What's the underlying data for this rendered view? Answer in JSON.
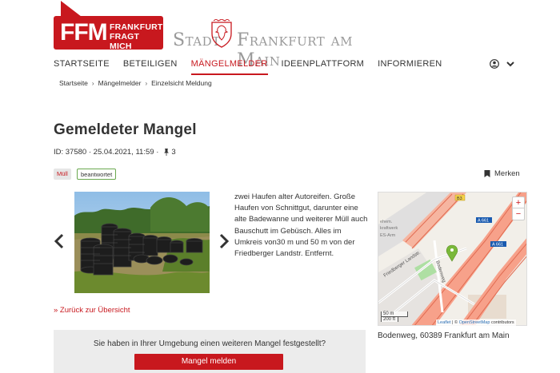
{
  "logo": {
    "abbr": "FFM",
    "line1": "FRANKFURT",
    "line2": "FRAGT MICH"
  },
  "city_logo": {
    "word1": "Stadt",
    "word2": "Frankfurt am Main"
  },
  "nav": {
    "items": [
      "STARTSEITE",
      "BETEILIGEN",
      "MÄNGELMELDER",
      "IDEENPLATTFORM",
      "INFORMIEREN"
    ],
    "active": "MÄNGELMELDER"
  },
  "breadcrumb": [
    "Startseite",
    "Mängelmelder",
    "Einzelsicht Meldung"
  ],
  "page_title": "Gemeldeter Mangel",
  "meta": {
    "id": "ID: 37580",
    "datetime": "25.04.2021, 11:59",
    "pins": "3"
  },
  "tags": {
    "category": "Müll",
    "status": "beantwortet"
  },
  "bookmark_label": "Merken",
  "description": "zwei Haufen alter Autoreifen. Große Haufen von Schnittgut, darunter eine alte Badewanne und weiterer Müll auch Bauschutt im Gebüsch. Alles im Umkreis von30 m und 50 m von der Friedberger Landstr. Entfernt.",
  "map": {
    "zoom_in": "+",
    "zoom_out": "−",
    "scale_m": "50 m",
    "scale_ft": "200 ft",
    "attribution_leaflet": "Leaflet",
    "attribution_sep": " | © ",
    "attribution_osm": "OpenStreetMap",
    "attribution_tail": " contributors",
    "labels": {
      "b3": "B3",
      "a661a": "A 661",
      "a661b": "A 661",
      "road": "Friedberger Landstr.",
      "street": "Bodenweg",
      "left1": "ehem.",
      "left2": "kraftwerk",
      "left3": "ES-Arm"
    }
  },
  "address": "Bodenweg, 60389 Frankfurt am Main",
  "back_link": "» Zurück zur Übersicht",
  "cta": {
    "question": "Sie haben in Ihrer Umgebung einen weiteren Mangel festgestellt?",
    "button": "Mangel melden"
  },
  "colors": {
    "brand": "#c8181e",
    "status_border": "#6aa84f",
    "cta_bg": "#ececec"
  }
}
